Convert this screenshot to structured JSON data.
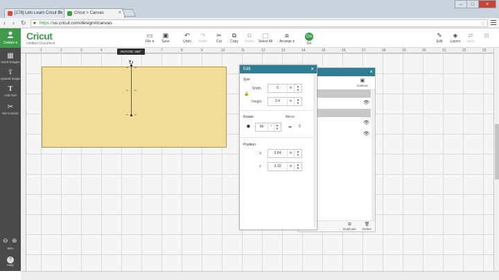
{
  "browser": {
    "tabs": [
      {
        "label": "[178] Lets Learn Cricut Ex",
        "close": "×",
        "favicon_color": "#d94a3a"
      },
      {
        "label": "Cricut > Canvas",
        "close": "×",
        "favicon_color": "#3f9a4a"
      }
    ],
    "window_buttons": [
      "–",
      "□",
      "×"
    ],
    "url_scheme": "https://",
    "url_rest": "us.cricut.com/design#/canvas",
    "nav": {
      "back": "‹",
      "forward": "›",
      "reload": "↻"
    }
  },
  "header": {
    "profile_name": "Debbie ▾",
    "brand": "Cricut",
    "doc_name": "Untitled Document",
    "tools": [
      {
        "name": "file",
        "icon": "▭",
        "label": "File ▾",
        "enabled": true
      },
      {
        "name": "save",
        "icon": "▣",
        "label": "Save",
        "enabled": true
      },
      {
        "name": "undo",
        "icon": "↶",
        "label": "Undo",
        "enabled": true
      },
      {
        "name": "redo",
        "icon": "↷",
        "label": "Redo",
        "enabled": false
      },
      {
        "name": "cut",
        "icon": "✂",
        "label": "Cut",
        "enabled": true
      },
      {
        "name": "copy",
        "icon": "⧉",
        "label": "Copy",
        "enabled": true
      },
      {
        "name": "paste",
        "icon": "⧉",
        "label": "Paste",
        "enabled": false
      },
      {
        "name": "select-all",
        "icon": "⬚",
        "label": "Select All",
        "enabled": true
      },
      {
        "name": "arrange",
        "icon": "⧈",
        "label": "Arrange ▾",
        "enabled": true
      }
    ],
    "go_label": "Go",
    "right_tools": [
      {
        "name": "edit",
        "icon": "✎",
        "label": "Edit",
        "enabled": true
      },
      {
        "name": "layers",
        "icon": "◈",
        "label": "Layers",
        "enabled": true
      },
      {
        "name": "sync",
        "icon": "⇄",
        "label": "Sync",
        "enabled": false
      },
      {
        "name": "attach",
        "icon": "⊞",
        "label": "",
        "enabled": false
      }
    ]
  },
  "rail": {
    "items": [
      {
        "name": "insert-images",
        "icon": "▦",
        "label": "Insert Images"
      },
      {
        "name": "upload-image",
        "icon": "⇪",
        "label": "Upload Image"
      },
      {
        "name": "add-text",
        "icon": "T",
        "label": "Add Text"
      },
      {
        "name": "set-contour",
        "icon": "✂",
        "label": "Set Contour"
      }
    ],
    "zoom_out": "⊖",
    "zoom_in": "⊕",
    "zoom_level": "90%",
    "help_icon": "?",
    "help_label": "Help"
  },
  "canvas": {
    "ruler_numbers": [
      "1",
      "2",
      "3",
      "4",
      "5",
      "6",
      "7",
      "8",
      "9",
      "10",
      "11",
      "12",
      "13",
      "14",
      "15",
      "16",
      "17",
      "18",
      "19",
      "20",
      "21",
      "22",
      "23"
    ],
    "rotate_tooltip": "ROTATE: 269°",
    "shape_color": "#f2dd98"
  },
  "layers_panel": {
    "contour_icon": "▣",
    "contour_label": "Contour",
    "eye_icon": "👁",
    "duplicate_label": "Duplicate",
    "delete_label": "Delete",
    "close": "×"
  },
  "edit_panel": {
    "title": "Edit",
    "close": "×",
    "size_label": "Size",
    "width_label": "Width",
    "width_value": "0",
    "height_label": "Height",
    "height_value": "2.4",
    "unit": "in",
    "rotate_label": "Rotate",
    "rotate_value": "90",
    "rotate_unit": "°",
    "mirror_label": "Mirror",
    "position_label": "Position",
    "x_label": "X",
    "x_value": "6.64",
    "y_label": "Y",
    "y_value": "2.15"
  },
  "colors": {
    "accent_green": "#3f9a4a",
    "panel_header": "#2f7d94",
    "rail_bg": "#4a4a4a"
  }
}
